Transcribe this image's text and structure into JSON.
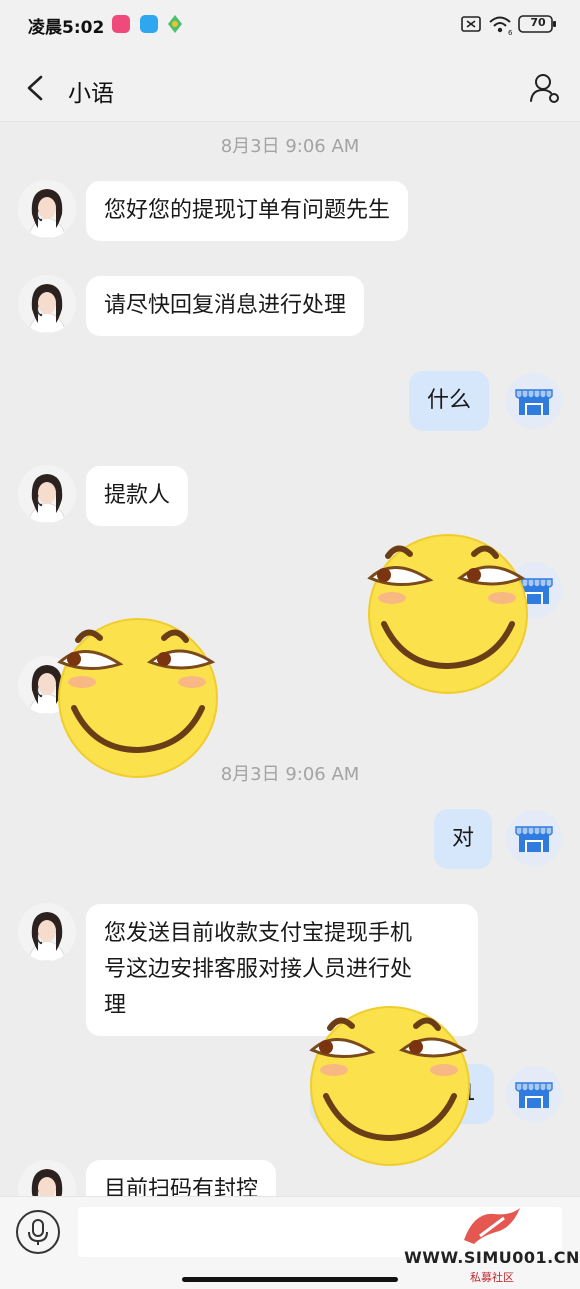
{
  "status_bar": {
    "time": "凌晨5:02",
    "battery": "70"
  },
  "nav": {
    "title": "小语"
  },
  "timestamps": [
    "8月3日 9:06 AM",
    "8月3日 9:06 AM"
  ],
  "messages": [
    {
      "side": "in",
      "text": "您好您的提现订单有问题先生"
    },
    {
      "side": "in",
      "text": "请尽快回复消息进行处理"
    },
    {
      "side": "out",
      "text": "什么"
    },
    {
      "side": "in",
      "text": "提款人"
    },
    {
      "side": "out",
      "text": "对"
    },
    {
      "side": "in",
      "text_lines": [
        "您发送目前收款支付宝提现手机",
        "号这边安排客服对接人员进行处",
        "理"
      ]
    },
    {
      "side": "out",
      "text": "1"
    },
    {
      "side": "in",
      "text": "目前扫码有封控"
    }
  ],
  "watermark": {
    "text": "WWW.SIMU001.CN",
    "subtext": "私募社区"
  },
  "colors": {
    "background": "#ededed",
    "incoming_bubble": "#ffffff",
    "outgoing_bubble": "#d6e6fb",
    "accent": "#2f7be0"
  }
}
